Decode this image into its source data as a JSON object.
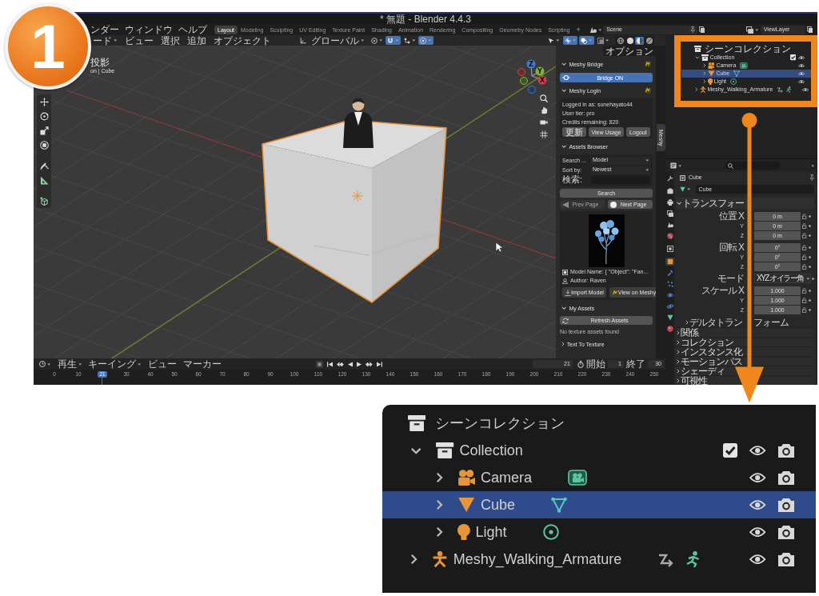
{
  "step_badge": {
    "label": "1"
  },
  "window": {
    "title": "* 無題 - Blender 4.4.3"
  },
  "topbar": {
    "menus": [
      "ンダー",
      "ウィンドウ",
      "ヘルプ"
    ],
    "workspaces": [
      {
        "label": "Layout",
        "selected": true
      },
      {
        "label": "Modeling",
        "selected": false
      },
      {
        "label": "Sculpting",
        "selected": false
      },
      {
        "label": "UV Editing",
        "selected": false
      },
      {
        "label": "Texture Paint",
        "selected": false
      },
      {
        "label": "Shading",
        "selected": false
      },
      {
        "label": "Animation",
        "selected": false
      },
      {
        "label": "Rendering",
        "selected": false
      },
      {
        "label": "Compositing",
        "selected": false
      },
      {
        "label": "Geometry Nodes",
        "selected": false
      },
      {
        "label": "Scripting",
        "selected": false
      }
    ],
    "add_workspace": "+",
    "scene": "Scene",
    "view_layer": "ViewLayer"
  },
  "viewport": {
    "menus": [
      {
        "label": "ード",
        "dropdown": true
      },
      {
        "label": "ビュー",
        "dropdown": false
      },
      {
        "label": "選択",
        "dropdown": false
      },
      {
        "label": "追加",
        "dropdown": false
      },
      {
        "label": "オブジェクト",
        "dropdown": false
      }
    ],
    "orientation": "グローバル",
    "snapping": [
      {
        "kind": "pivot",
        "on": false
      },
      {
        "kind": "snap",
        "on": true
      },
      {
        "kind": "snap_target",
        "on": false
      },
      {
        "kind": "proportional",
        "on": true
      }
    ],
    "display": [
      {
        "kind": "visibility",
        "on": false
      },
      {
        "kind": "gizmos",
        "on": true
      },
      {
        "kind": "overlays",
        "on": true
      },
      {
        "kind": "xray",
        "on": false
      }
    ],
    "shading_modes": [
      {
        "kind": "wireframe",
        "selected": false
      },
      {
        "kind": "solid",
        "selected": false
      },
      {
        "kind": "material",
        "selected": true
      },
      {
        "kind": "rendered",
        "selected": false
      }
    ],
    "info_lines": [
      "投影",
      "on | Cube"
    ],
    "gizmo_axes": [
      "Z",
      "Y",
      "X"
    ]
  },
  "sidebar": {
    "options": "オプション",
    "tabs": [
      {
        "label": "Meshy",
        "selected": true
      }
    ],
    "panels": [
      {
        "kind": "bridge",
        "title": "Meshy Bridge",
        "expanded": true,
        "button": "Bridge ON"
      },
      {
        "kind": "login",
        "title": "Meshy Login",
        "expanded": true,
        "lines": [
          "Logged in as: sonehayato44",
          "User tier: pro",
          "Credits remaining: 820"
        ],
        "buttons": [
          "更新",
          "View Usage",
          "Logout"
        ]
      },
      {
        "kind": "browser",
        "title": "Assets Browser",
        "expanded": true,
        "fields": [
          {
            "label": "Search ...",
            "value": "Model",
            "kind": "dropdown"
          },
          {
            "label": "Sort by:",
            "value": "Newest",
            "kind": "dropdown"
          },
          {
            "label": "検索:",
            "kind": "text"
          }
        ],
        "search_button": "Search",
        "pager": [
          {
            "label": "Prev Page",
            "kind": "prev",
            "disabled": true
          },
          {
            "label": "Next Page",
            "kind": "next",
            "disabled": false
          }
        ],
        "model_name": "Model Name: {  \"Object\": \"Fan...",
        "author": "Author: Raven",
        "actions": [
          {
            "label": "Import Model",
            "kind": "import"
          },
          {
            "label": "View on Meshy",
            "kind": "web"
          }
        ]
      },
      {
        "kind": "assets",
        "title": "My Assets",
        "expanded": true,
        "button": "Refresh Assets",
        "message": "No texture assets found"
      },
      {
        "kind": "texture",
        "title": "Text To Texture",
        "expanded": false
      }
    ]
  },
  "outliner": {
    "root": "シーンコレクション",
    "items": [
      {
        "label": "Collection",
        "kind": "collection",
        "expanded": true,
        "selected": false,
        "checked": true,
        "visible": true,
        "children": [
          {
            "label": "Camera",
            "kind": "camera",
            "expanded": false,
            "selected": false,
            "visible": true
          },
          {
            "label": "Cube",
            "kind": "mesh",
            "expanded": false,
            "selected": true,
            "visible": true
          },
          {
            "label": "Light",
            "kind": "light",
            "expanded": false,
            "selected": false,
            "visible": true
          }
        ]
      },
      {
        "label": "Meshy_Walking_Armature",
        "kind": "armature",
        "expanded": false,
        "selected": false,
        "visible": true
      }
    ]
  },
  "properties": {
    "tab_groups": [
      [
        {
          "kind": "tool",
          "selected": false
        }
      ],
      [
        {
          "kind": "render",
          "selected": false
        },
        {
          "kind": "output",
          "selected": false
        },
        {
          "kind": "view_layer",
          "selected": false
        },
        {
          "kind": "scene",
          "selected": false
        },
        {
          "kind": "world",
          "selected": false
        }
      ],
      [
        {
          "kind": "collection",
          "selected": false
        }
      ],
      [
        {
          "kind": "object",
          "selected": true
        },
        {
          "kind": "modifiers",
          "selected": false
        },
        {
          "kind": "particles",
          "selected": false
        },
        {
          "kind": "physics",
          "selected": false
        },
        {
          "kind": "constraints",
          "selected": false
        },
        {
          "kind": "data",
          "selected": false
        },
        {
          "kind": "material",
          "selected": false
        }
      ]
    ],
    "object": "Cube",
    "datablock": "Cube",
    "transform": {
      "title": "トランスフォー",
      "expanded": true,
      "groups": [
        {
          "rows": [
            {
              "label": "位置 X",
              "value": "0 m",
              "kind": "number"
            },
            {
              "label": "Y",
              "value": "0 m",
              "kind": "number"
            },
            {
              "label": "Z",
              "value": "0 m",
              "kind": "number"
            }
          ]
        },
        {
          "rows": [
            {
              "label": "回転 X",
              "value": "0°",
              "kind": "number"
            },
            {
              "label": "Y",
              "value": "0°",
              "kind": "number"
            },
            {
              "label": "Z",
              "value": "0°",
              "kind": "number"
            }
          ]
        },
        {
          "rows": [
            {
              "label": "モード",
              "value": "XYZ オイラー角",
              "kind": "dropdown"
            }
          ]
        },
        {
          "rows": [
            {
              "label": "スケール X",
              "value": "1.000",
              "kind": "number"
            },
            {
              "label": "Y",
              "value": "1.000",
              "kind": "number"
            },
            {
              "label": "Z",
              "value": "1.000",
              "kind": "number"
            }
          ]
        }
      ],
      "subpanel": {
        "title_parts": [
          "デルタトラン",
          "フォーム"
        ],
        "expanded": false
      }
    },
    "panels": [
      {
        "title": "関係",
        "expanded": false
      },
      {
        "title": "コレクション",
        "expanded": false
      },
      {
        "title": "インスタンス化",
        "expanded": false
      },
      {
        "title": "モーションパス",
        "expanded": false
      },
      {
        "title": "シェーディ",
        "expanded": false
      },
      {
        "title": "可視性",
        "expanded": false
      }
    ]
  },
  "timeline": {
    "menus": [
      {
        "label": "再生",
        "dropdown": true
      },
      {
        "label": "キーイング",
        "dropdown": true
      },
      {
        "label": "ビュー",
        "dropdown": false
      },
      {
        "label": "マーカー",
        "dropdown": false
      }
    ],
    "current_frame": "21",
    "start_label": "開始",
    "start": "1",
    "end_label": "終了",
    "end": "30",
    "ruler": [
      {
        "label": "0",
        "selected": false
      },
      {
        "label": "10",
        "selected": false
      },
      {
        "label": "21",
        "selected": true
      },
      {
        "label": "30",
        "selected": false
      },
      {
        "label": "40",
        "selected": false
      },
      {
        "label": "50",
        "selected": false
      },
      {
        "label": "60",
        "selected": false
      },
      {
        "label": "70",
        "selected": false
      },
      {
        "label": "80",
        "selected": false
      },
      {
        "label": "90",
        "selected": false
      },
      {
        "label": "100",
        "selected": false
      },
      {
        "label": "110",
        "selected": false
      },
      {
        "label": "120",
        "selected": false
      },
      {
        "label": "130",
        "selected": false
      },
      {
        "label": "140",
        "selected": false
      },
      {
        "label": "150",
        "selected": false
      },
      {
        "label": "160",
        "selected": false
      },
      {
        "label": "170",
        "selected": false
      },
      {
        "label": "180",
        "selected": false
      },
      {
        "label": "190",
        "selected": false
      },
      {
        "label": "200",
        "selected": false
      },
      {
        "label": "210",
        "selected": false
      },
      {
        "label": "220",
        "selected": false
      },
      {
        "label": "230",
        "selected": false
      },
      {
        "label": "240",
        "selected": false
      },
      {
        "label": "250",
        "selected": false
      }
    ]
  },
  "detail_view": {
    "root": "シーンコレクション",
    "items": [
      {
        "label": "Collection",
        "kind": "collection",
        "expanded": true,
        "selected": false,
        "checked": true,
        "visible": true,
        "children": [
          {
            "label": "Camera",
            "kind": "camera",
            "expanded": false,
            "selected": false,
            "visible": true
          },
          {
            "label": "Cube",
            "kind": "mesh",
            "expanded": false,
            "selected": true,
            "visible": true
          },
          {
            "label": "Light",
            "kind": "light",
            "expanded": false,
            "selected": false,
            "visible": true
          }
        ]
      },
      {
        "label": "Meshy_Walking_Armature",
        "kind": "armature",
        "expanded": false,
        "selected": false,
        "visible": true
      }
    ]
  }
}
